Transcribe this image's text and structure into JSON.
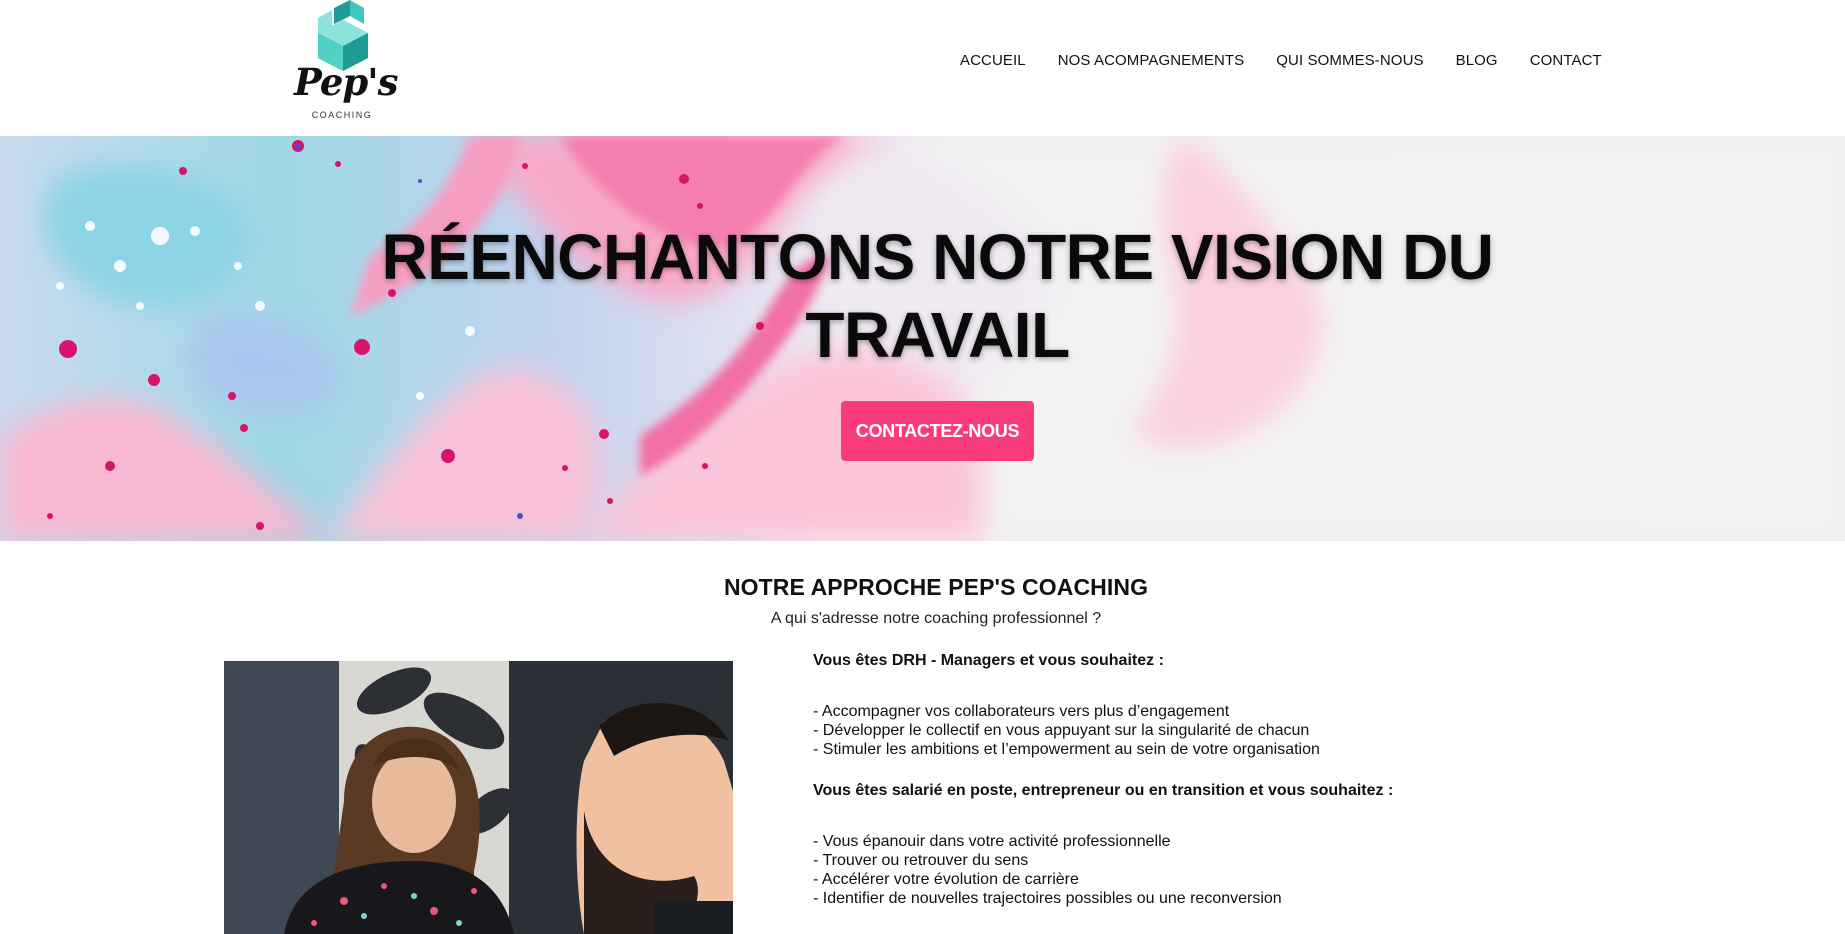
{
  "brand": {
    "name": "Pep's",
    "tagline": "COACHING",
    "colors": {
      "accent": "#fa3d7a",
      "logo_teal_light": "#8ee3da",
      "logo_teal": "#3fc7bb",
      "logo_teal_dark": "#1f9a95"
    }
  },
  "nav": {
    "items": [
      {
        "label": "ACCUEIL"
      },
      {
        "label": "NOS ACOMPAGNEMENTS"
      },
      {
        "label": "QUI SOMMES-NOUS"
      },
      {
        "label": "BLOG"
      },
      {
        "label": "CONTACT"
      }
    ]
  },
  "hero": {
    "title_line1": "RÉENCHANTONS NOTRE VISION DU",
    "title_line2": "TRAVAIL",
    "cta_label": "CONTACTEZ-NOUS"
  },
  "approach": {
    "title": "NOTRE APPROCHE PEP'S COACHING",
    "subtitle": "A qui s'adresse notre coaching professionnel ?",
    "group1": {
      "lead": "Vous êtes DRH - Managers et vous souhaitez :",
      "items": [
        "- Accompagner vos collaborateurs vers plus d’engagement",
        "- Développer le collectif en vous appuyant sur la singularité de chacun",
        "- Stimuler les ambitions et l’empowerment au sein de votre organisation"
      ]
    },
    "group2": {
      "lead": "Vous êtes salarié en poste, entrepreneur ou en transition et vous souhaitez :",
      "items": [
        "- Vous épanouir dans votre activité professionnelle",
        "- Trouver ou retrouver du sens",
        "- Accélérer votre évolution de carrière",
        "- Identifier de nouvelles trajectoires possibles ou une reconversion"
      ]
    }
  }
}
